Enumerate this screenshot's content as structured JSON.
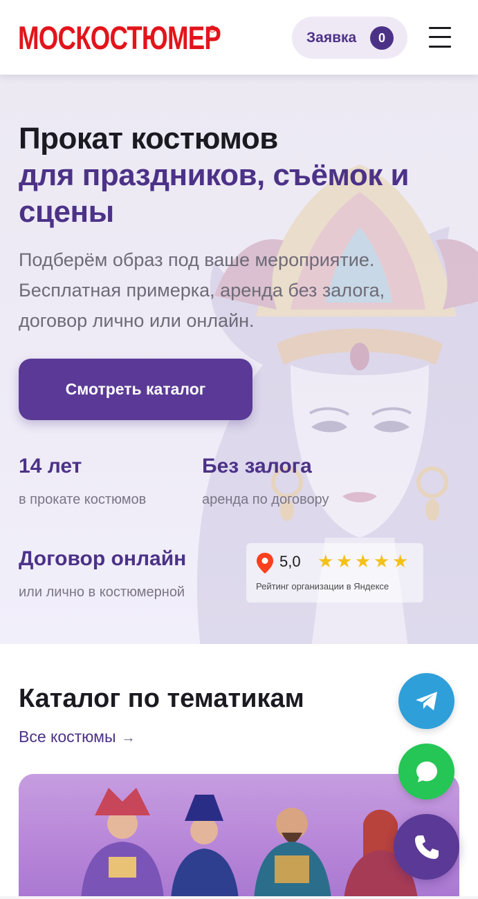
{
  "header": {
    "logo_text": "МОСКОСТЮМЕР",
    "logo_registered": "R",
    "order_label": "Заявка",
    "order_count": "0",
    "menu_icon": "hamburger-icon",
    "brand_color": "#e3141b"
  },
  "hero": {
    "title_line1": "Прокат костюмов",
    "title_line2": "для праздников, съёмок и сцены",
    "subtitle": "Подберём образ под ваше мероприятие. Бесплатная примерка, аренда без залога, договор лично или онлайн.",
    "cta_label": "Смотреть каталог",
    "accent_color": "#4c3287",
    "stats": [
      {
        "title": "14 лет",
        "subtitle": "в прокате костюмов"
      },
      {
        "title": "Без залога",
        "subtitle": "аренда по договору"
      },
      {
        "title": "Договор онлайн",
        "subtitle": "или лично в костюмерной"
      }
    ],
    "rating": {
      "value": "5,0",
      "stars": 5,
      "label": "Рейтинг организации в Яндексе",
      "icon": "map-pin-icon"
    }
  },
  "catalog": {
    "title": "Каталог по тематикам",
    "all_link": "Все костюмы",
    "all_link_arrow": "→"
  },
  "floating": {
    "telegram_icon": "telegram-icon",
    "chat_icon": "chat-bubble-icon",
    "phone_icon": "phone-icon"
  }
}
